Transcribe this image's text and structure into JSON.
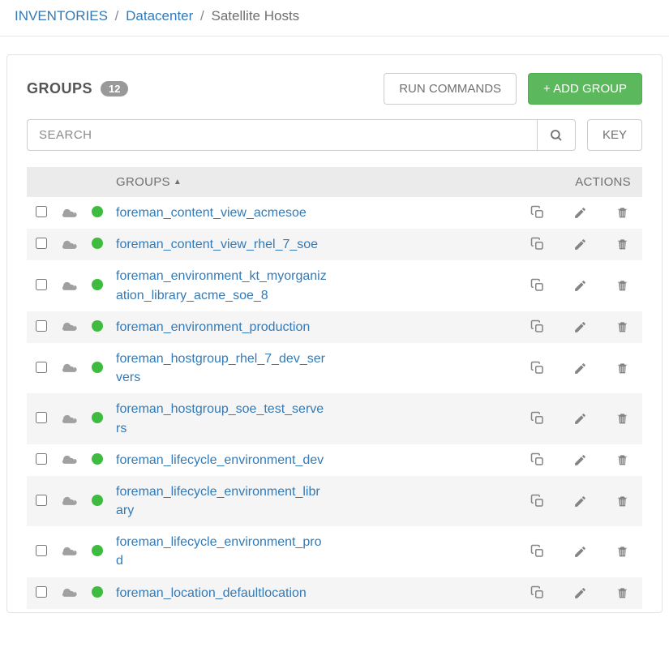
{
  "breadcrumb": {
    "root": "INVENTORIES",
    "parent": "Datacenter",
    "current": "Satellite Hosts"
  },
  "header": {
    "title": "GROUPS",
    "count": "12",
    "run_commands_label": "RUN COMMANDS",
    "add_group_label": "+ ADD GROUP"
  },
  "search": {
    "placeholder": "SEARCH",
    "key_label": "KEY"
  },
  "table": {
    "col_groups": "GROUPS",
    "col_actions": "ACTIONS"
  },
  "rows": [
    {
      "name": "foreman_content_view_acmesoe"
    },
    {
      "name": "foreman_content_view_rhel_7_soe"
    },
    {
      "name": "foreman_environment_kt_myorganization_library_acme_soe_8"
    },
    {
      "name": "foreman_environment_production"
    },
    {
      "name": "foreman_hostgroup_rhel_7_dev_servers"
    },
    {
      "name": "foreman_hostgroup_soe_test_servers"
    },
    {
      "name": "foreman_lifecycle_environment_dev"
    },
    {
      "name": "foreman_lifecycle_environment_library"
    },
    {
      "name": "foreman_lifecycle_environment_prod"
    },
    {
      "name": "foreman_location_defaultlocation"
    }
  ]
}
